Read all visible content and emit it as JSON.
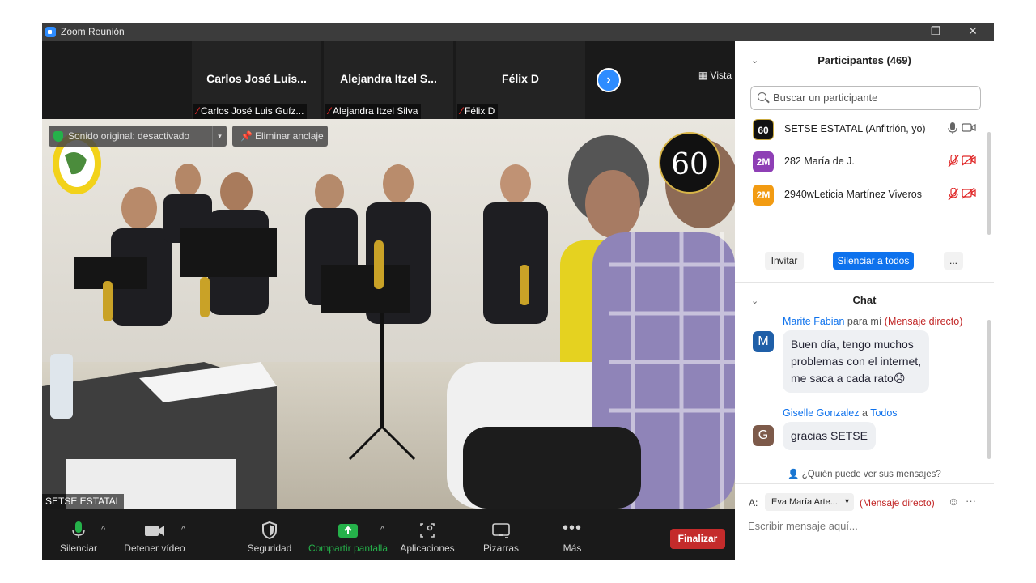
{
  "window": {
    "title": "Zoom Reunión",
    "controls": [
      "–",
      "❐",
      "✕"
    ]
  },
  "gallery": {
    "tiles": [
      {
        "big": "Carlos José Luis...",
        "small": "Carlos José Luis Guíz..."
      },
      {
        "big": "Alejandra  Itzel S...",
        "small": "Alejandra Itzel Silva"
      },
      {
        "big": "Félix D",
        "small": "Félix D"
      }
    ],
    "view_label": "Vista",
    "next_icon": "chevron-right-icon"
  },
  "video": {
    "original_sound": "Sonido original: desactivado",
    "unpin": "Eliminar anclaje",
    "speaker_label": "SETSE ESTATAL",
    "badge_number": "60"
  },
  "toolbar": {
    "mute": "Silenciar",
    "stop_video": "Detener vídeo",
    "security": "Seguridad",
    "share": "Compartir pantalla",
    "apps": "Aplicaciones",
    "whiteboards": "Pizarras",
    "more": "Más",
    "end": "Finalizar"
  },
  "participants": {
    "title": "Participantes (469)",
    "search_placeholder": "Buscar un participante",
    "list": [
      {
        "avatar": "60",
        "name": "SETSE ESTATAL (Anfitrión, yo)",
        "color": "#111111",
        "muted": false
      },
      {
        "avatar": "2M",
        "name": "282 María de J.",
        "color": "#8e3fb5",
        "muted": true
      },
      {
        "avatar": "2M",
        "name": "2940wLeticia Martínez Viveros",
        "color": "#f29b12",
        "muted": true
      }
    ],
    "invite": "Invitar",
    "mute_all": "Silenciar a todos",
    "more": "..."
  },
  "chat": {
    "title": "Chat",
    "messages": [
      {
        "from": "Marite Fabian",
        "connector": "para mí",
        "to": "(Mensaje directo)",
        "avatar": "M",
        "color": "#1f5fa8",
        "lines": [
          "Buen día, tengo muchos",
          "problemas con el internet,",
          "me saca a cada rato😞"
        ]
      },
      {
        "from": "Giselle Gonzalez",
        "connector": "a",
        "to": "Todos",
        "avatar": "G",
        "color": "#7d5a4a",
        "lines": [
          "gracias SETSE"
        ]
      }
    ],
    "who_can_see": "¿Quién puede ver sus mensajes?",
    "to_label": "A:",
    "recipient": "Eva María Arte...",
    "dm_tag": "(Mensaje directo)",
    "input_placeholder": "Escribir mensaje aquí..."
  }
}
